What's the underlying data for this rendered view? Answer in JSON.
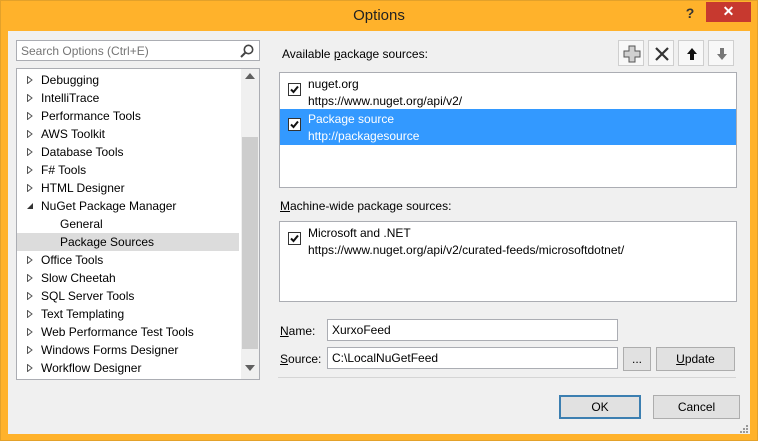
{
  "window": {
    "title": "Options",
    "help_label": "?",
    "close_label": "✕"
  },
  "search": {
    "placeholder": "Search Options (Ctrl+E)"
  },
  "tree": {
    "items": [
      {
        "label": "Debugging",
        "expanded": false
      },
      {
        "label": "IntelliTrace",
        "expanded": false
      },
      {
        "label": "Performance Tools",
        "expanded": false
      },
      {
        "label": "AWS Toolkit",
        "expanded": false
      },
      {
        "label": "Database Tools",
        "expanded": false
      },
      {
        "label": "F# Tools",
        "expanded": false
      },
      {
        "label": "HTML Designer",
        "expanded": false
      },
      {
        "label": "NuGet Package Manager",
        "expanded": true
      },
      {
        "label": "General",
        "child": true
      },
      {
        "label": "Package Sources",
        "child": true,
        "selected": true
      },
      {
        "label": "Office Tools",
        "expanded": false
      },
      {
        "label": "Slow Cheetah",
        "expanded": false
      },
      {
        "label": "SQL Server Tools",
        "expanded": false
      },
      {
        "label": "Text Templating",
        "expanded": false
      },
      {
        "label": "Web Performance Test Tools",
        "expanded": false
      },
      {
        "label": "Windows Forms Designer",
        "expanded": false
      },
      {
        "label": "Workflow Designer",
        "expanded": false
      }
    ]
  },
  "available": {
    "label_prefix": "Available ",
    "label_accel": "p",
    "label_suffix": "ackage sources:",
    "sources": [
      {
        "name": "nuget.org",
        "url": "https://www.nuget.org/api/v2/",
        "checked": true,
        "selected": false
      },
      {
        "name": "Package source",
        "url": "http://packagesource",
        "checked": true,
        "selected": true
      }
    ]
  },
  "toolbar": {
    "add_icon": "add-icon",
    "remove_icon": "remove-icon",
    "move_up_icon": "arrow-up-icon",
    "move_down_icon": "arrow-down-icon"
  },
  "machine_wide": {
    "label_accel": "M",
    "label_rest": "achine-wide package sources:",
    "sources": [
      {
        "name": "Microsoft and .NET",
        "url": "https://www.nuget.org/api/v2/curated-feeds/microsoftdotnet/",
        "checked": true
      }
    ]
  },
  "form": {
    "name_accel": "N",
    "name_rest": "ame:",
    "name_value": "XurxoFeed",
    "source_accel": "S",
    "source_rest": "ource:",
    "source_value": "C:\\LocalNuGetFeed",
    "browse_label": "...",
    "update_accel": "U",
    "update_rest": "pdate"
  },
  "footer": {
    "ok_label": "OK",
    "cancel_label": "Cancel"
  },
  "colors": {
    "titlebar": "#ffb22b",
    "close": "#c7392f",
    "selection": "#3399ff"
  }
}
